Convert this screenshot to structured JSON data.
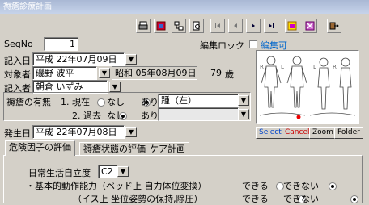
{
  "window": {
    "title": "褥瘡診療計画"
  },
  "toolbar": {
    "icons": [
      "print-icon",
      "calendar-icon",
      "tree-icon",
      "preview-icon",
      "first-icon",
      "prev-icon",
      "next-icon",
      "last-icon",
      "new-icon",
      "delete-icon",
      "exit-icon"
    ]
  },
  "edit_lock": {
    "label": "編集ロック",
    "state": "編集可",
    "state_color": "#0066cc"
  },
  "seqno": {
    "label": "SeqNo",
    "value": "1"
  },
  "entry_date": {
    "label": "記入日",
    "value": "平成 22年07月09日"
  },
  "patient": {
    "label": "対象者",
    "name": "磯野 波平",
    "dob": "昭和 05年08月09日",
    "age": "79",
    "age_unit": "歳"
  },
  "recorder": {
    "label": "記入者",
    "value": "朝倉 いずみ"
  },
  "ulcer": {
    "label": "褥瘡の有無",
    "current": {
      "label": "1. 現在",
      "opt_none": "なし",
      "opt_yes": "あり",
      "selected": "あり",
      "site": "踵（左）"
    },
    "past": {
      "label": "2. 過去",
      "opt_none": "なし",
      "opt_yes": "あり",
      "selected": "なし",
      "site": ""
    }
  },
  "body_map": {
    "side_labels": [
      "R",
      "L",
      "L",
      "R"
    ],
    "buttons": {
      "select": "Select",
      "cancel": "Cancel",
      "zoom": "Zoom",
      "folder": "Folder"
    },
    "select_color": "#0044cc",
    "cancel_color": "#cc0000"
  },
  "onset_date": {
    "label": "発生日",
    "value": "平成 22年07月08日"
  },
  "tabs": [
    {
      "label": "危険因子の評価",
      "active": true
    },
    {
      "label": "褥瘡状態の評価",
      "active": false
    },
    {
      "label": "ケア計画",
      "active": false
    }
  ],
  "risk": {
    "adl_label": "日常生活自立度",
    "adl_value": "C2",
    "basic_label": "・基本的動作能力（ベッド上 自力体位変換）",
    "opt_can": "できる",
    "opt_cannot": "できない",
    "basic_selected": "できない",
    "sitting_label": "（イス上 坐位姿勢の保持,除圧）",
    "sitting_selected": "できない"
  }
}
